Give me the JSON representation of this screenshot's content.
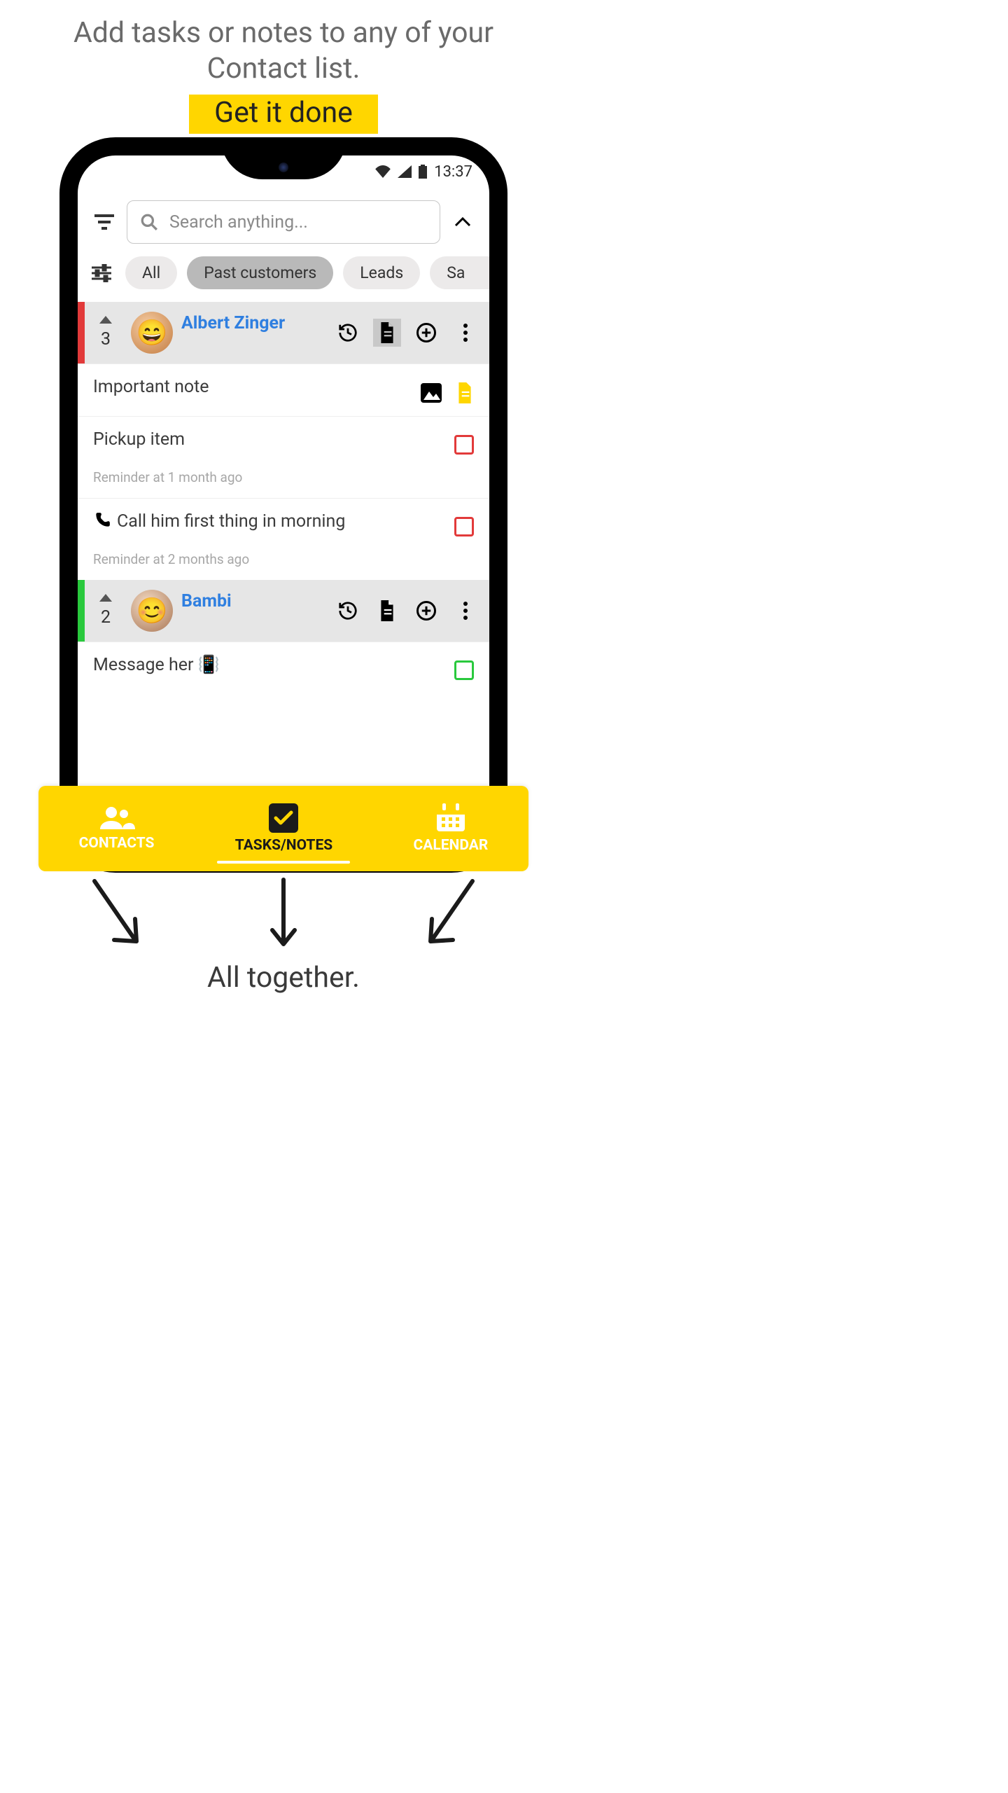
{
  "heading": "Add tasks or notes to any of your Contact list.",
  "subhead": "Get it done",
  "status": {
    "time": "13:37"
  },
  "search": {
    "placeholder": "Search anything..."
  },
  "chips": {
    "all": "All",
    "past_customers": "Past customers",
    "leads": "Leads",
    "next_partial": "Sa"
  },
  "contacts": [
    {
      "name": "Albert Zinger",
      "count": "3",
      "stripe": "#e23a3a",
      "items": [
        {
          "type": "note",
          "title": "Important note"
        },
        {
          "type": "task",
          "title": "Pickup item",
          "reminder": "Reminder at 1 month ago",
          "checkbox_color": "#e23a3a"
        },
        {
          "type": "task",
          "title": "Call him first thing in morning",
          "icon": "phone",
          "reminder": "Reminder at 2 months ago",
          "checkbox_color": "#e23a3a"
        }
      ]
    },
    {
      "name": "Bambi",
      "count": "2",
      "stripe": "#29c93d",
      "items": [
        {
          "type": "task",
          "title": "Message her 📳",
          "checkbox_color": "#29c93d"
        }
      ]
    }
  ],
  "nav": {
    "contacts": "CONTACTS",
    "tasks": "TASKS/NOTES",
    "calendar": "CALENDAR"
  },
  "footer": "All together."
}
